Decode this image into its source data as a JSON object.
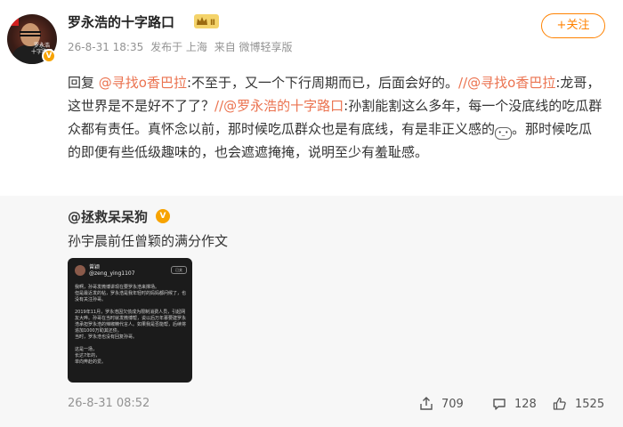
{
  "header": {
    "username": "罗永浩的十字路口",
    "member_level": "Ⅱ",
    "avatar_caption": "罗永浩\n十字路口",
    "verify_badge": "V",
    "time": "26-8-31 18:35",
    "location": "发布于 上海",
    "source": "来自 微博轻享版",
    "follow_label": "+关注"
  },
  "post": {
    "reply_prefix": "回复 ",
    "mention1": "@寻找o香巴拉",
    "text1": ":不至于，又一个下行周期而已，后面会好的。",
    "sep1": "//",
    "mention2": "@寻找o香巴拉",
    "text2": ":龙哥，这世界是不是好不了了？",
    "sep2": "//",
    "mention3": "@罗永浩的十字路口",
    "text3": ":孙割能割这么多年，每一个没底线的吃瓜群众都有责任。真怀念以前，那时候吃瓜群众也是有底线，有是非正义感的",
    "emoji_label": "•_•",
    "text4": "。那时候吃瓜的即便有些低级趣味的，也会遮遮掩掩，说明至少有羞耻感。"
  },
  "repost": {
    "user": "@拯救呆呆狗",
    "verify_badge": "V",
    "text": "孙宇晨前任曾颖的满分作文",
    "thumbnail": {
      "name": "曾颖\n@zeng_ying1107",
      "button": "已关",
      "body": "我啊，孙哥发微博讲现在要罗永浩来撑场。\n但是最近发的帖，罗永浩是我年轻时的妈妈都问候了，也没有关注孙哥。\n\n2019年11月，罗永浩因欠债成为限制消费人员，引起网友大哗。孙哥在当时就发微博帮，说以后万年慕要建罗永浩承担罗永浩的辣椒精代言人。如果我是否能帮，后续将追加1000万助其还债。\n当时，罗永浩也没有回复孙哥。\n\n这是一场，\n长达7年的，\n单向奔赴的爱。"
    },
    "time": "26-8-31 08:52",
    "reposts": "709",
    "comments": "128",
    "likes": "1525"
  }
}
